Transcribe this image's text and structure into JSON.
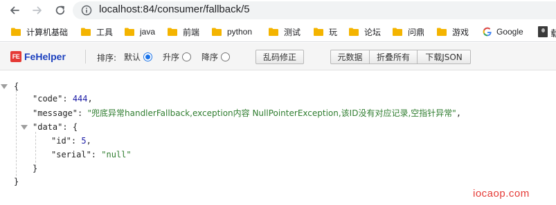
{
  "browser": {
    "url": "localhost:84/consumer/fallback/5"
  },
  "bookmarks": [
    {
      "label": "计算机基础",
      "icon": "folder-icon"
    },
    {
      "label": "工具",
      "icon": "folder-icon"
    },
    {
      "label": "java",
      "icon": "folder-icon"
    },
    {
      "label": "前端",
      "icon": "folder-icon"
    },
    {
      "label": "python",
      "icon": "folder-icon"
    },
    {
      "label": "测试",
      "icon": "folder-icon"
    },
    {
      "label": "玩",
      "icon": "folder-icon"
    },
    {
      "label": "论坛",
      "icon": "folder-icon"
    },
    {
      "label": "问鼎",
      "icon": "folder-icon"
    },
    {
      "label": "游戏",
      "icon": "folder-icon"
    },
    {
      "label": "Google",
      "icon": "google-icon"
    }
  ],
  "bookmarks_overflow_glyph": "载",
  "fehelper": {
    "logo_text": "FeHelper",
    "logo_mark": "FE",
    "sort_label": "排序:",
    "sort_options": [
      {
        "label": "默认",
        "checked": true
      },
      {
        "label": "升序",
        "checked": false
      },
      {
        "label": "降序",
        "checked": false
      }
    ],
    "buttons": {
      "fix_encoding": "乱码修正",
      "raw_data": "元数据",
      "collapse_all": "折叠所有",
      "download_json": "下载JSON"
    }
  },
  "json": {
    "open_brace": "{",
    "close_brace": "}",
    "code_key": "\"code\"",
    "code_value": "444",
    "message_key": "\"message\"",
    "message_value": "\"兜底异常handlerFallback,exception内容 NullPointerException,该ID没有对应记录,空指针异常\"",
    "data_key": "\"data\"",
    "data_open": "{",
    "data_close": "}",
    "id_key": "\"id\"",
    "id_value": "5",
    "serial_key": "\"serial\"",
    "serial_value": "\"null\""
  },
  "watermark": "iocaop.com",
  "colors": {
    "json_number": "#1a1aa6",
    "json_string": "#2f7d2f",
    "fehelper_logo": "#1a3fbe",
    "watermark": "#e53935",
    "radio_checked": "#1a73e8"
  }
}
